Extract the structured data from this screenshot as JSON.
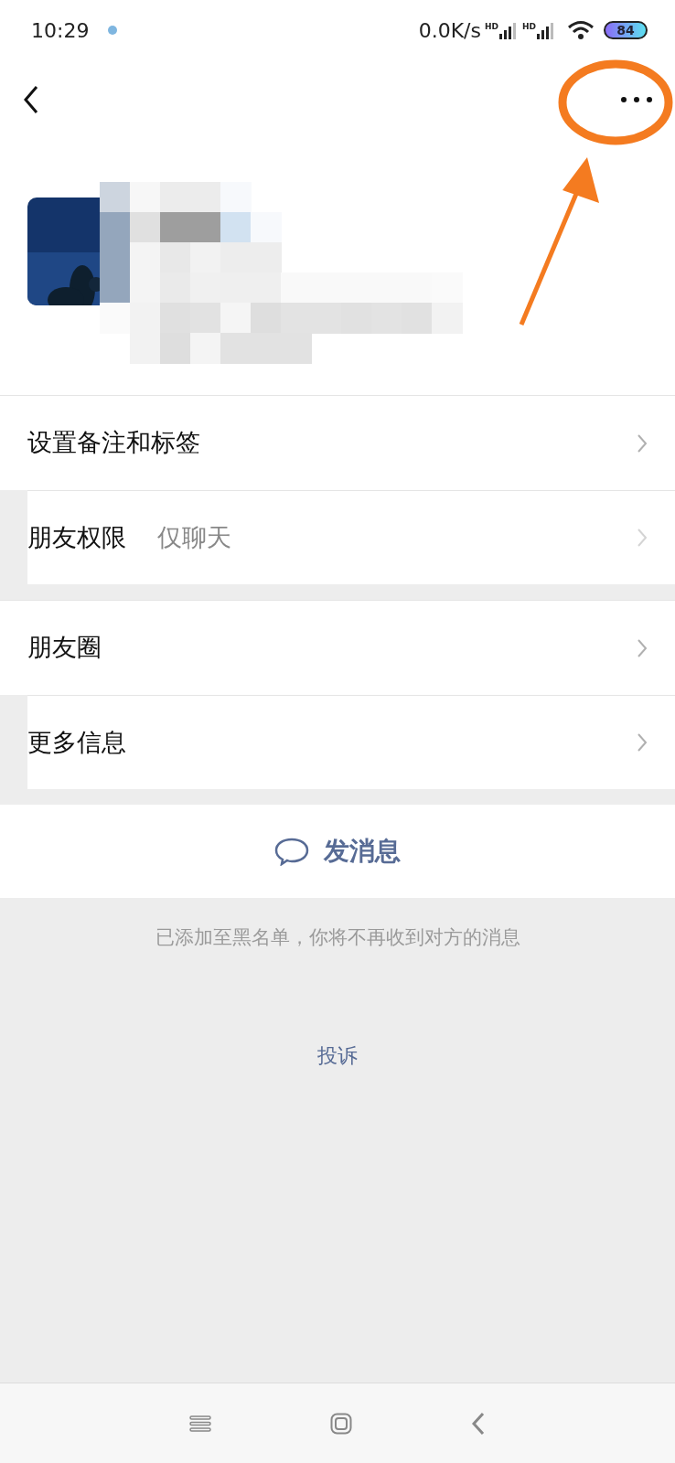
{
  "status_bar": {
    "time": "10:29",
    "net_speed": "0.0K/s",
    "signal_labels": [
      "HD",
      "HD"
    ],
    "battery": "84"
  },
  "sections": [
    {
      "rows": [
        {
          "label": "设置备注和标签"
        },
        {
          "label": "朋友权限",
          "value": "仅聊天"
        }
      ]
    },
    {
      "rows": [
        {
          "label": "朋友圈"
        },
        {
          "label": "更多信息"
        }
      ]
    }
  ],
  "send_button": {
    "label": "发消息"
  },
  "notice": "已添加至黑名单，你将不再收到对方的消息",
  "complaint_link": "投诉"
}
